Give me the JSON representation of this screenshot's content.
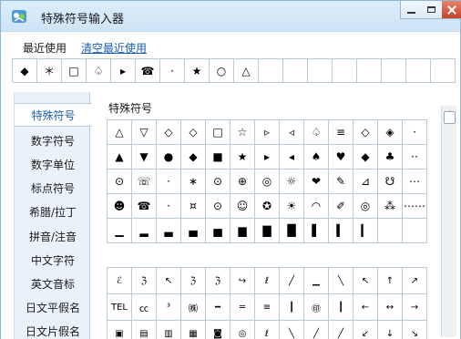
{
  "window": {
    "title": "特殊符号输入器",
    "min_label": "",
    "max_label": "",
    "close_label": ""
  },
  "recent": {
    "label": "最近使用",
    "clear_link": "清空最近使用",
    "symbols": [
      "◆",
      "＊",
      "□",
      "♤",
      "▸",
      "☎",
      "·",
      "★",
      "○",
      "△",
      "",
      "",
      "",
      "",
      "",
      "",
      "",
      ""
    ]
  },
  "sidebar": {
    "items": [
      {
        "label": "特殊符号",
        "active": true
      },
      {
        "label": "数字符号",
        "active": false
      },
      {
        "label": "数字单位",
        "active": false
      },
      {
        "label": "标点符号",
        "active": false
      },
      {
        "label": "希腊/拉丁",
        "active": false
      },
      {
        "label": "拼音/注音",
        "active": false
      },
      {
        "label": "中文字符",
        "active": false
      },
      {
        "label": "英文音标",
        "active": false
      },
      {
        "label": "日文平假名",
        "active": false
      },
      {
        "label": "日文片假名",
        "active": false
      }
    ]
  },
  "section": {
    "title": "特殊符号"
  },
  "symbol_grid_1": [
    [
      "△",
      "▽",
      "◇",
      "◇",
      "□",
      "☆",
      "▹",
      "◃",
      "♤",
      "≡",
      "◇",
      "◈",
      "·"
    ],
    [
      "▲",
      "▼",
      "●",
      "◆",
      "■",
      "★",
      "▸",
      "◂",
      "♠",
      "♥",
      "◆",
      "♣",
      "··"
    ],
    [
      "⊙",
      "☏",
      "·",
      "∗",
      "⊙",
      "⊕",
      "◎",
      "☼",
      "❤",
      "✎",
      "⊿",
      "☋",
      "⋯"
    ],
    [
      "☻",
      "☎",
      "·",
      "¤",
      "⊙",
      "☺",
      "✪",
      "☀",
      "◠",
      "✐",
      "◎",
      "⁂",
      "⋯⋯"
    ],
    [
      "▁",
      "▂",
      "▃",
      "▄",
      "▅",
      "▆",
      "▇",
      "█",
      "▌",
      "▍",
      "▎",
      "",
      ""
    ]
  ],
  "symbol_grid_2": [
    [
      "ℰ",
      "ℨ",
      "↖",
      "ℨ",
      "ℨ",
      "↪",
      "ℓ",
      "╱",
      "▁",
      "╲",
      "↖",
      "↑",
      "↗"
    ],
    [
      "TEL",
      "㏄",
      "³",
      "㈱",
      "━",
      "═",
      "≡",
      "┃",
      "㊞",
      "┃",
      "←",
      "↔",
      "→"
    ],
    [
      "▣",
      "▤",
      "▥",
      "▦",
      "◙",
      "◎",
      "ℓ",
      "╲",
      "╱",
      "╱",
      "↙",
      "↓",
      "↘"
    ]
  ]
}
